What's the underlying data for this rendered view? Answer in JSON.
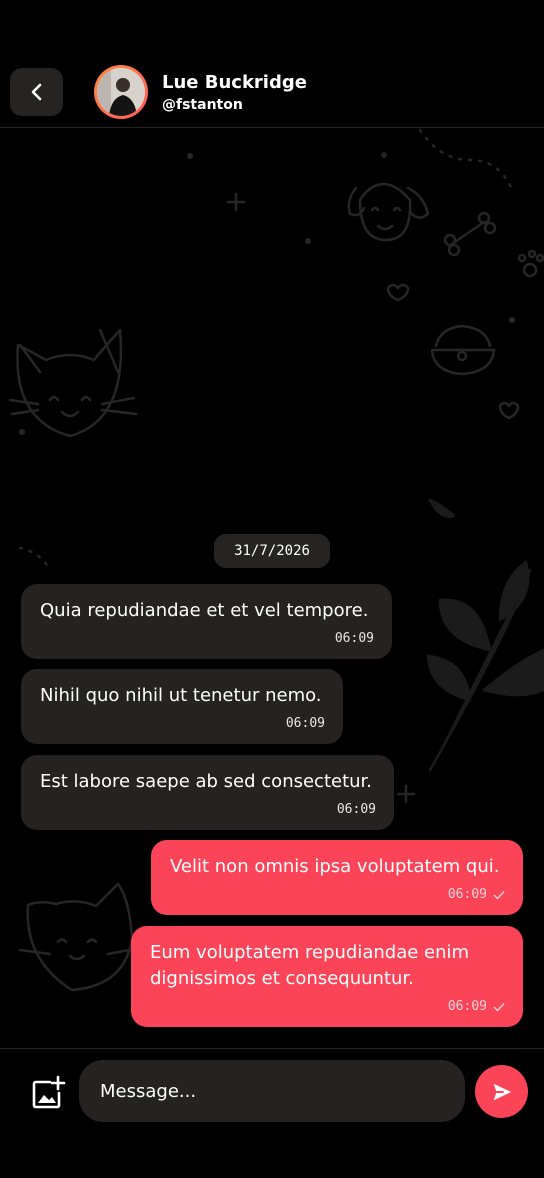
{
  "header": {
    "name": "Lue Buckridge",
    "handle": "@fstanton"
  },
  "date_divider": "31/7/2026",
  "messages": [
    {
      "direction": "incoming",
      "text": "Quia repudiandae et et vel tempore.",
      "time": "06:09"
    },
    {
      "direction": "incoming",
      "text": "Nihil quo nihil ut tenetur nemo.",
      "time": "06:09"
    },
    {
      "direction": "incoming",
      "text": "Est labore saepe ab sed consectetur.",
      "time": "06:09"
    },
    {
      "direction": "outgoing",
      "text": "Velit non omnis ipsa voluptatem qui.",
      "time": "06:09",
      "status": "sent"
    },
    {
      "direction": "outgoing",
      "text": "Eum voluptatem repudiandae enim\ndignissimos et consequuntur.",
      "time": "06:09",
      "status": "sent"
    }
  ],
  "composer": {
    "placeholder": "Message..."
  },
  "icons": {
    "back": "chevron-left-icon",
    "attach": "add-image-icon",
    "send": "send-icon",
    "read_receipt": "checkmark-icon"
  },
  "colors": {
    "accent": "#fc4459",
    "bubble_incoming": "#252221",
    "background": "#000000"
  }
}
